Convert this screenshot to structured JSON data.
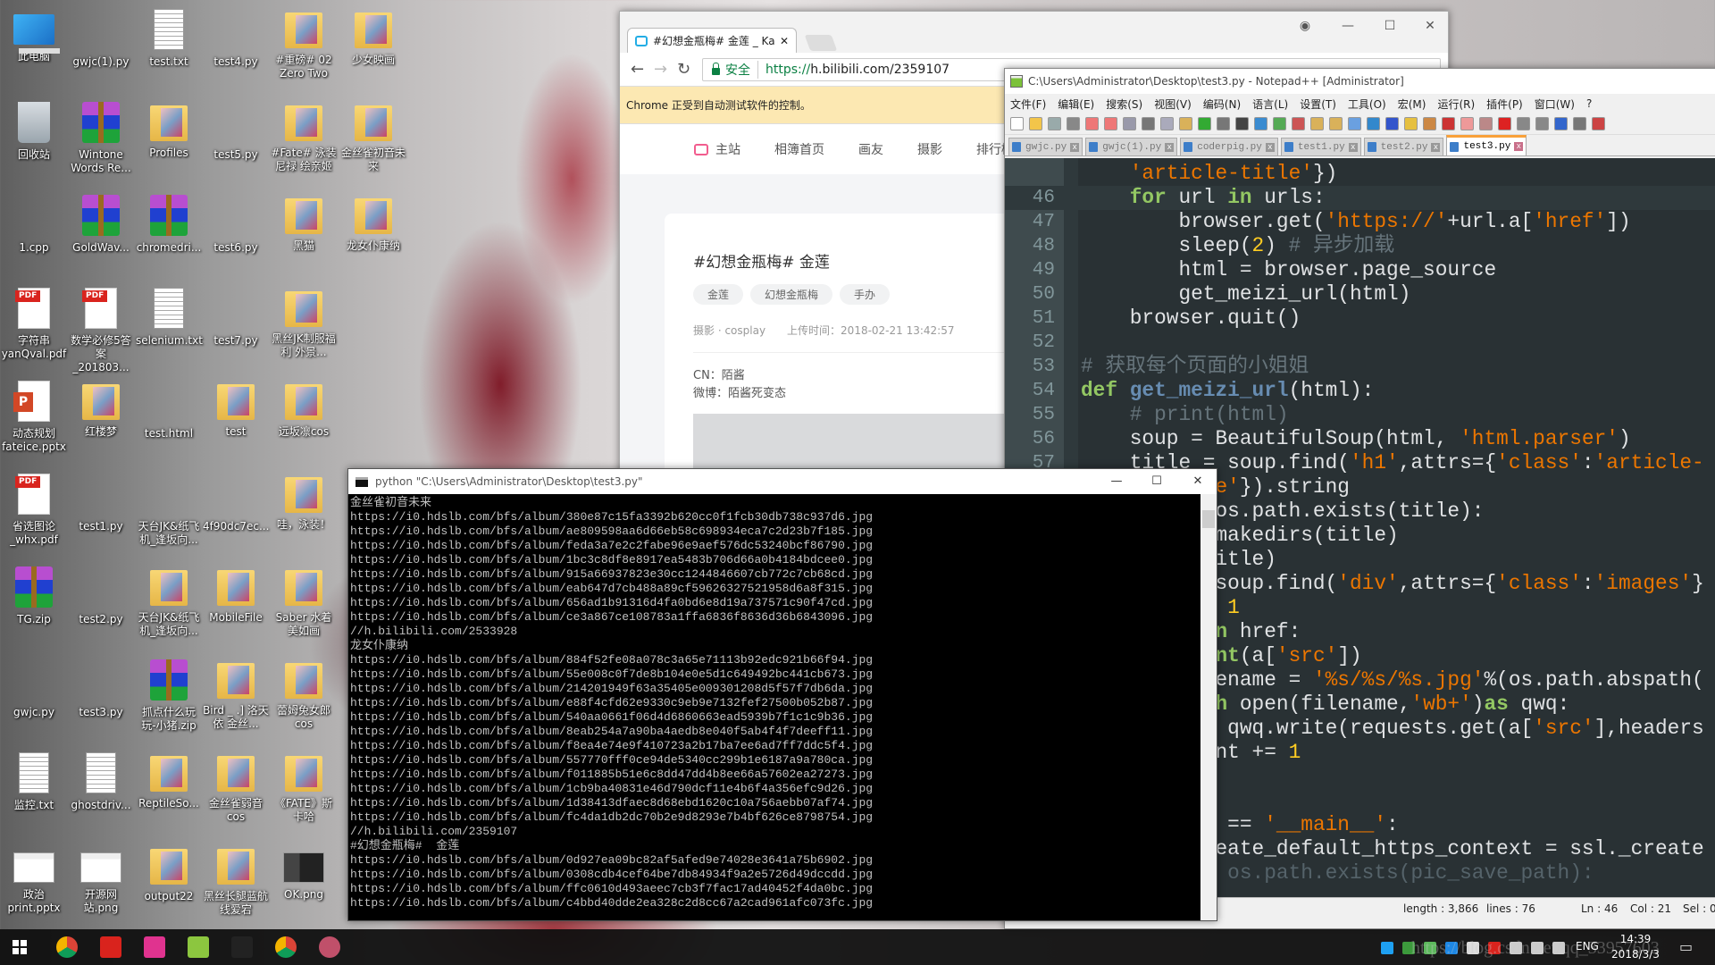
{
  "desktop": {
    "icons": [
      [
        {
          "label": "此电脑",
          "icon": "pc"
        },
        {
          "label": "gwjc(1).py",
          "icon": "npp"
        },
        {
          "label": "test.txt",
          "icon": "txt"
        },
        {
          "label": "test4.py",
          "icon": "npp"
        },
        {
          "label": "#重磅# 02 Zero Two",
          "icon": "folder"
        },
        {
          "label": "少女映画",
          "icon": "folder"
        }
      ],
      [
        {
          "label": "回收站",
          "icon": "bin"
        },
        {
          "label": "Wintone Words Re...",
          "icon": "rar"
        },
        {
          "label": "Profiles",
          "icon": "folder"
        },
        {
          "label": "test5.py",
          "icon": "npp"
        },
        {
          "label": "#Fate# 泳装 尼禄 绘亲姬",
          "icon": "folder"
        },
        {
          "label": "金丝雀初音未来",
          "icon": "folder"
        }
      ],
      [
        {
          "label": "1.cpp",
          "icon": "npp"
        },
        {
          "label": "GoldWav...",
          "icon": "rar"
        },
        {
          "label": "chromedri...",
          "icon": "rar"
        },
        {
          "label": "test6.py",
          "icon": "npp"
        },
        {
          "label": "黑猫",
          "icon": "folder"
        },
        {
          "label": "龙女仆康纳",
          "icon": "folder"
        }
      ],
      [
        {
          "label": "字符串 yanQval.pdf",
          "icon": "pdf"
        },
        {
          "label": "数学必修5答案_201803...",
          "icon": "pdf"
        },
        {
          "label": "selenium.txt",
          "icon": "txt"
        },
        {
          "label": "test7.py",
          "icon": "npp"
        },
        {
          "label": "黑丝JK制服福利 外景...",
          "icon": "folder"
        }
      ],
      [
        {
          "label": "动态规划 fateice.pptx",
          "icon": "pptx"
        },
        {
          "label": "红楼梦",
          "icon": "folder"
        },
        {
          "label": "test.html",
          "icon": "chrome"
        },
        {
          "label": "test",
          "icon": "folder"
        },
        {
          "label": "远坂凛cos",
          "icon": "folder"
        }
      ],
      [
        {
          "label": "省选图论_whx.pdf",
          "icon": "pdf"
        },
        {
          "label": "test1.py",
          "icon": "npp"
        },
        {
          "label": "天台JK&纸飞机_逢坂向...",
          "icon": "chrome"
        },
        {
          "label": "4f90dc7ec...",
          "icon": "chrome"
        },
        {
          "label": "哇，泳装！",
          "icon": "folder"
        }
      ],
      [
        {
          "label": "TG.zip",
          "icon": "rar"
        },
        {
          "label": "test2.py",
          "icon": "npp"
        },
        {
          "label": "天台JK&纸飞机_逢坂向...",
          "icon": "folder"
        },
        {
          "label": "MobileFile",
          "icon": "folder"
        },
        {
          "label": "Saber 水着 美如画",
          "icon": "folder"
        }
      ],
      [
        {
          "label": "gwjc.py",
          "icon": "npp"
        },
        {
          "label": "test3.py",
          "icon": "npp"
        },
        {
          "label": "抓点什么玩玩-小猪.zip",
          "icon": "rar"
        },
        {
          "label": "Bird _ .] 洛天依 金丝...",
          "icon": "folder"
        },
        {
          "label": "蕾姆兔女郎cos",
          "icon": "folder"
        }
      ],
      [
        {
          "label": "监控.txt",
          "icon": "txt"
        },
        {
          "label": "ghostdriv...",
          "icon": "txt"
        },
        {
          "label": "ReptileSo...",
          "icon": "folder"
        },
        {
          "label": "金丝雀弱音cos",
          "icon": "folder"
        },
        {
          "label": "《FATE》斯卡哈",
          "icon": "folder"
        }
      ],
      [
        {
          "label": "政治print.pptx",
          "icon": "png"
        },
        {
          "label": "开源网站.png",
          "icon": "png"
        },
        {
          "label": "output22",
          "icon": "folder"
        },
        {
          "label": "黑丝长腿蓝航线爱宕",
          "icon": "folder"
        },
        {
          "label": "OK.png",
          "icon": "png-dark"
        }
      ]
    ]
  },
  "chrome": {
    "tab_title": "#幻想金瓶梅# 金莲 _ Ka",
    "secure_label": "安全",
    "url_scheme": "https://",
    "url_rest": "h.bilibili.com/2359107",
    "infobar": "Chrome 正受到自动测试软件的控制。",
    "nav": [
      "主站",
      "相簿首页",
      "画友",
      "摄影",
      "排行榜"
    ],
    "post": {
      "title": "#幻想金瓶梅# 金莲",
      "tags": [
        "金莲",
        "幻想金瓶梅",
        "手办"
      ],
      "category": "摄影 · cosplay",
      "upload_time": "上传时间：2018-02-21 13:42:57",
      "cn": "CN：陌酱",
      "weibo": "微博：陌酱死变态"
    }
  },
  "notepad": {
    "title": "C:\\Users\\Administrator\\Desktop\\test3.py - Notepad++ [Administrator]",
    "menu": [
      "文件(F)",
      "编辑(E)",
      "搜索(S)",
      "视图(V)",
      "编码(N)",
      "语言(L)",
      "设置(T)",
      "工具(O)",
      "宏(M)",
      "运行(R)",
      "插件(P)",
      "窗口(W)",
      "?"
    ],
    "tabs": [
      {
        "label": "gwjc.py",
        "active": false
      },
      {
        "label": "gwjc(1).py",
        "active": false
      },
      {
        "label": "coderpig.py",
        "active": false
      },
      {
        "label": "test1.py",
        "active": false
      },
      {
        "label": "test2.py",
        "active": false
      },
      {
        "label": "test3.py",
        "active": true
      }
    ],
    "current_line": 46,
    "code": [
      {
        "num": "",
        "seg": [
          [
            "    ",
            ""
          ],
          [
            "'article-title'",
            "s"
          ],
          [
            "})",
            ""
          ]
        ]
      },
      {
        "num": "46",
        "seg": [
          [
            "    ",
            ""
          ],
          [
            "for",
            "k"
          ],
          [
            " url ",
            ""
          ],
          [
            "in",
            "k"
          ],
          [
            " urls:",
            ""
          ]
        ]
      },
      {
        "num": "47",
        "seg": [
          [
            "        browser.get(",
            ""
          ],
          [
            "'https://'",
            "s"
          ],
          [
            "+url.a[",
            ""
          ],
          [
            "'href'",
            "s"
          ],
          [
            "])",
            ""
          ]
        ]
      },
      {
        "num": "48",
        "seg": [
          [
            "        sleep(",
            ""
          ],
          [
            "2",
            "n"
          ],
          [
            ") ",
            ""
          ],
          [
            "# 异步加载",
            "c"
          ]
        ]
      },
      {
        "num": "49",
        "seg": [
          [
            "        html = browser.page_source",
            ""
          ]
        ]
      },
      {
        "num": "50",
        "seg": [
          [
            "        get_meizi_url(html)",
            ""
          ]
        ]
      },
      {
        "num": "51",
        "seg": [
          [
            "    browser.quit()",
            ""
          ]
        ]
      },
      {
        "num": "52",
        "seg": []
      },
      {
        "num": "53",
        "seg": [
          [
            "# 获取每个页面的小姐姐",
            "c"
          ]
        ]
      },
      {
        "num": "54",
        "seg": [
          [
            "def",
            "k"
          ],
          [
            " ",
            ""
          ],
          [
            "get_meizi_url",
            "f"
          ],
          [
            "(html):",
            ""
          ]
        ]
      },
      {
        "num": "55",
        "seg": [
          [
            "    ",
            ""
          ],
          [
            "# print(html)",
            "c"
          ]
        ]
      },
      {
        "num": "56",
        "seg": [
          [
            "    soup = BeautifulSoup(html, ",
            ""
          ],
          [
            "'html.parser'",
            "s"
          ],
          [
            ")",
            ""
          ]
        ]
      },
      {
        "num": "57",
        "seg": [
          [
            "    title = soup.find(",
            ""
          ],
          [
            "'h1'",
            "s"
          ],
          [
            ",attrs={",
            ""
          ],
          [
            "'class'",
            "s"
          ],
          [
            ":",
            ""
          ],
          [
            "'article-",
            "s"
          ]
        ]
      },
      {
        "num": "",
        "seg": [
          [
            "           ",
            ""
          ],
          [
            "e'",
            "s"
          ],
          [
            "}).string",
            ""
          ]
        ]
      },
      {
        "num": "",
        "seg": [
          [
            "           os.path.exists(title):",
            ""
          ]
        ]
      },
      {
        "num": "",
        "seg": [
          [
            "           makedirs(title)",
            ""
          ]
        ]
      },
      {
        "num": "",
        "seg": [
          [
            "           itle)",
            ""
          ]
        ]
      },
      {
        "num": "",
        "seg": [
          [
            "           soup.find(",
            ""
          ],
          [
            "'div'",
            "s"
          ],
          [
            ",attrs={",
            ""
          ],
          [
            "'class'",
            "s"
          ],
          [
            ":",
            ""
          ],
          [
            "'images'",
            "s"
          ],
          [
            "}",
            ""
          ]
        ]
      },
      {
        "num": "",
        "seg": [
          [
            "            ",
            ""
          ],
          [
            "1",
            "n"
          ]
        ]
      },
      {
        "num": "",
        "seg": [
          [
            "           ",
            ""
          ],
          [
            "n",
            "k"
          ],
          [
            " href:",
            ""
          ]
        ]
      },
      {
        "num": "",
        "seg": [
          [
            "           ",
            ""
          ],
          [
            "nt",
            "k"
          ],
          [
            "(a[",
            ""
          ],
          [
            "'src'",
            "s"
          ],
          [
            "])",
            ""
          ]
        ]
      },
      {
        "num": "",
        "seg": [
          [
            "           ename = ",
            ""
          ],
          [
            "'%s/%s/%s.jpg'",
            "s"
          ],
          [
            "%(os.path.abspath(",
            ""
          ]
        ]
      },
      {
        "num": "",
        "seg": [
          [
            "           ",
            ""
          ],
          [
            "h",
            "k"
          ],
          [
            " open(filename,",
            ""
          ],
          [
            "'wb+'",
            "s"
          ],
          [
            ")",
            ""
          ],
          [
            "as",
            "k"
          ],
          [
            " qwq:",
            ""
          ]
        ]
      },
      {
        "num": "",
        "seg": [
          [
            "            qwq.write(requests.get(a[",
            ""
          ],
          [
            "'src'",
            "s"
          ],
          [
            "],headers",
            ""
          ]
        ]
      },
      {
        "num": "",
        "seg": [
          [
            "           nt += ",
            ""
          ],
          [
            "1",
            "n"
          ]
        ]
      },
      {
        "num": "",
        "seg": []
      },
      {
        "num": "",
        "seg": []
      },
      {
        "num": "",
        "seg": [
          [
            "            == ",
            ""
          ],
          [
            "'__main__'",
            "s"
          ],
          [
            ":",
            ""
          ]
        ]
      },
      {
        "num": "",
        "seg": [
          [
            "           eate_default_https_context = ssl._create",
            ""
          ]
        ]
      },
      {
        "num": "",
        "seg": [
          [
            "            os.path.exists(pic_save_path):",
            "m"
          ]
        ]
      }
    ],
    "status": {
      "length": "length : 3,866",
      "lines": "lines : 76",
      "ln": "Ln : 46",
      "col": "Col : 21",
      "sel": "Sel : 0"
    }
  },
  "console": {
    "title": "python  \"C:\\Users\\Administrator\\Desktop\\test3.py\"",
    "lines": [
      "金丝雀初音未来",
      "https://i0.hdslb.com/bfs/album/380e87c15fa3392b620cc0f1fcb30db738c937d6.jpg",
      "https://i0.hdslb.com/bfs/album/ae809598aa6d66eb58c698934eca7c2d23b7f185.jpg",
      "https://i0.hdslb.com/bfs/album/feda3a7e2c2fabe96e9aef576dc53240bcf86790.jpg",
      "https://i0.hdslb.com/bfs/album/1bc3c8df8e8917ea5483b706d66a0b4184bdcee0.jpg",
      "https://i0.hdslb.com/bfs/album/915a66937823e30cc1244846607cb772c7cb68cd.jpg",
      "https://i0.hdslb.com/bfs/album/eab647d7cb488a89cf59626327521958d6a8f315.jpg",
      "https://i0.hdslb.com/bfs/album/656ad1b91316d4fa0bd6e8d19a737571c90f47cd.jpg",
      "https://i0.hdslb.com/bfs/album/ce3a867ce108783a1ffa6836f8636d36b6843096.jpg",
      "//h.bilibili.com/2533928",
      "龙女仆康纳",
      "https://i0.hdslb.com/bfs/album/884f52fe08a078c3a65e71113b92edc921b66f94.jpg",
      "https://i0.hdslb.com/bfs/album/55e008c0f7de8b104e0e5d1c649492bc441cb673.jpg",
      "https://i0.hdslb.com/bfs/album/214201949f63a35405e009301208d5f57f7db6da.jpg",
      "https://i0.hdslb.com/bfs/album/e88f4cfd62e9330c9eb9e7132fef27500b052b87.jpg",
      "https://i0.hdslb.com/bfs/album/540aa0661f06d4d6860663ead5939b7f1c1c9b36.jpg",
      "https://i0.hdslb.com/bfs/album/8eab254a7a90ba4aedb8e040f5ab4f4f7deeff11.jpg",
      "https://i0.hdslb.com/bfs/album/f8ea4e74e9f410723a2b17ba7ee6ad7ff7ddc5f4.jpg",
      "https://i0.hdslb.com/bfs/album/557770fff0ce94de5340cc299b1e6187a9a780ca.jpg",
      "https://i0.hdslb.com/bfs/album/f011885b51e6c8dd47dd4b8ee66a57602ea27273.jpg",
      "https://i0.hdslb.com/bfs/album/1cb9ba40831e46d790dcf11e4b6f4a356efc9d26.jpg",
      "https://i0.hdslb.com/bfs/album/1d38413dfaec8d68ebd1620c10a756aebb07af74.jpg",
      "https://i0.hdslb.com/bfs/album/fc4da1db2dc70b2e9d8293e7b4bf626ce8798754.jpg",
      "//h.bilibili.com/2359107",
      "#幻想金瓶梅#  金莲",
      "https://i0.hdslb.com/bfs/album/0d927ea09bc82af5afed9e74028e3641a75b6902.jpg",
      "https://i0.hdslb.com/bfs/album/0308cdb4cef64be7db84934f9a2e5726d49dccdd.jpg",
      "https://i0.hdslb.com/bfs/album/ffc0610d493aeec7cb3f7fac17ad40452f4da0bc.jpg",
      "https://i0.hdslb.com/bfs/album/c4bbd40dde2ea328c2d8cc67a2cad961afc073fc.jpg"
    ]
  },
  "taskbar": {
    "apps": [
      {
        "icon": "chrome-icon",
        "color": "#f4b400"
      },
      {
        "icon": "netease-music-icon",
        "color": "#d9231d"
      },
      {
        "icon": "paper-plane-icon",
        "color": "#e0338f"
      },
      {
        "icon": "notepadpp-icon",
        "color": "#8cc63f"
      },
      {
        "icon": "cmd-icon",
        "color": "#222222"
      },
      {
        "icon": "chrome-icon",
        "color": "#f4b400"
      },
      {
        "icon": "avatar-app-icon",
        "color": "#c0506a"
      }
    ],
    "tray": [
      {
        "icon": "qq-icon",
        "color": "#1ea0f1"
      },
      {
        "icon": "network-globe-icon",
        "color": "#3c9a3c"
      },
      {
        "icon": "plane-icon",
        "color": "#5cb85c"
      },
      {
        "icon": "app-icon",
        "color": "#1e88e5"
      },
      {
        "icon": "display-icon",
        "color": "#dddddd"
      },
      {
        "icon": "netease-icon",
        "color": "#d9231d"
      },
      {
        "icon": "usb-icon",
        "color": "#cccccc"
      },
      {
        "icon": "network-icon",
        "color": "#cccccc"
      },
      {
        "icon": "volume-icon",
        "color": "#cccccc"
      }
    ],
    "language": "ENG",
    "time": "14:39",
    "date": "2018/3/3"
  },
  "watermark": "https://blog.csdn.net/qq_33957603"
}
